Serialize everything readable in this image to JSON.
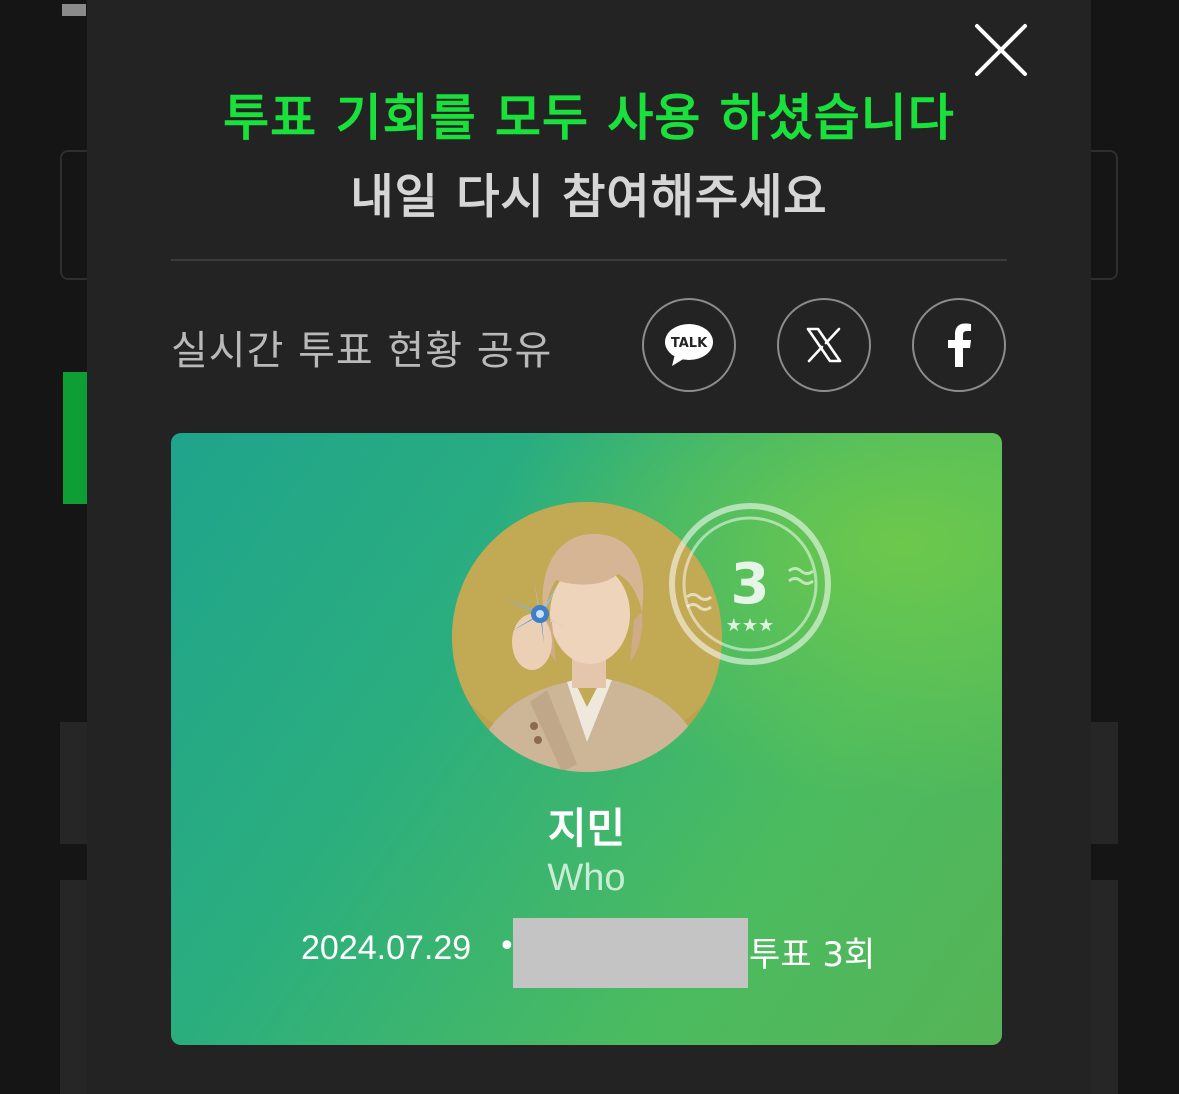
{
  "modal": {
    "title": "투표 기회를 모두 사용 하셨습니다",
    "subtitle": "내일 다시 참여해주세요",
    "share_label": "실시간 투표 현황 공유",
    "share_buttons": [
      {
        "name": "kakao-talk",
        "icon": "kakaotalk-icon",
        "icon_text": "TALK"
      },
      {
        "name": "x",
        "icon": "x-logo-icon"
      },
      {
        "name": "facebook",
        "icon": "facebook-icon"
      }
    ]
  },
  "vote_card": {
    "artist": "지민",
    "song": "Who",
    "date": "2024.07.29",
    "separator": "•",
    "vote_count_text": "투표 3회",
    "stamp_number": "3",
    "stamp_stars": "★★★"
  },
  "colors": {
    "accent_green": "#19e03a",
    "modal_bg": "#232323",
    "card_gradient_start": "#1fa48c",
    "card_gradient_end": "#55b456"
  }
}
